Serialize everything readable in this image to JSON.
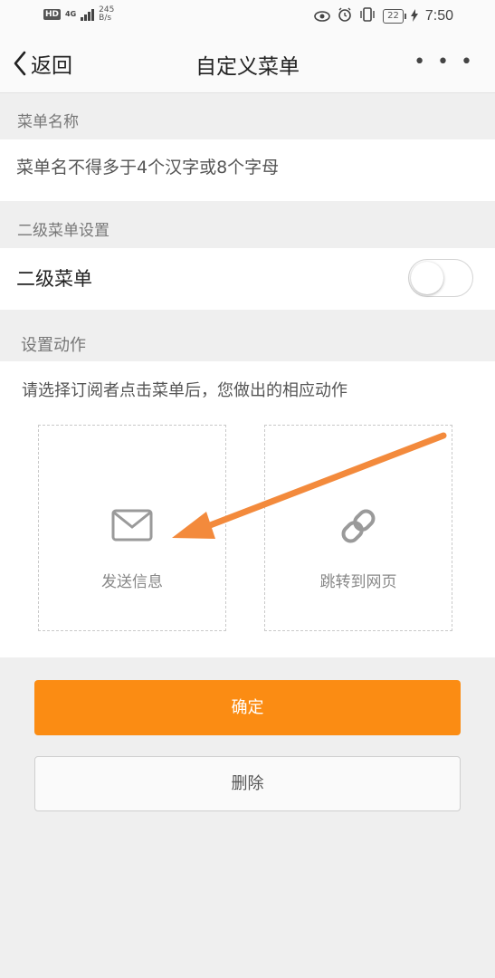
{
  "status_bar": {
    "hd": "HD",
    "network": "4G",
    "speed_value": "245",
    "speed_unit": "B/s",
    "battery": "22",
    "time": "7:50"
  },
  "header": {
    "back_label": "返回",
    "title": "自定义菜单",
    "more": "• • •"
  },
  "menu_name": {
    "section_label": "菜单名称",
    "placeholder": "菜单名不得多于4个汉字或8个字母",
    "value": ""
  },
  "submenu": {
    "section_label": "二级菜单设置",
    "row_label": "二级菜单",
    "enabled": false
  },
  "action": {
    "section_label": "设置动作",
    "description": "请选择订阅者点击菜单后，您做出的相应动作",
    "options": [
      {
        "label": "发送信息",
        "icon": "envelope-icon"
      },
      {
        "label": "跳转到网页",
        "icon": "link-icon"
      }
    ],
    "annotation_arrow_color": "#f38a3c"
  },
  "buttons": {
    "confirm": "确定",
    "delete": "删除"
  },
  "colors": {
    "accent": "#fb8c13",
    "background": "#efefef"
  }
}
